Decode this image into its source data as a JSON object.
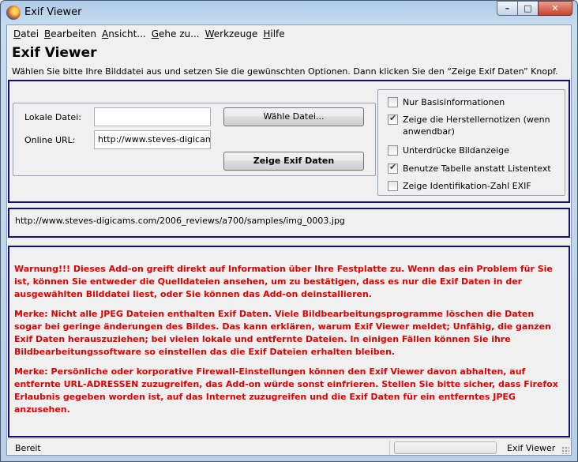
{
  "window": {
    "title": "Exif Viewer",
    "buttons": {
      "minimize": "–",
      "maximize": "□",
      "close": "✕"
    }
  },
  "menubar": {
    "items": [
      {
        "label": "Datei",
        "accel": "D",
        "rest": "atei"
      },
      {
        "label": "Bearbeiten",
        "accel": "B",
        "rest": "earbeiten"
      },
      {
        "label": "Ansicht...",
        "accel": "A",
        "rest": "nsicht..."
      },
      {
        "label": "Gehe zu...",
        "accel": "G",
        "rest": "ehe zu..."
      },
      {
        "label": "Werkzeuge",
        "accel": "W",
        "rest": "erkzeuge"
      },
      {
        "label": "Hilfe",
        "accel": "H",
        "rest": "ilfe"
      }
    ]
  },
  "header": {
    "title": "Exif Viewer",
    "instruction": "Wählen Sie bitte Ihre Bilddatei aus und setzen Sie die gewünschten Optionen. Dann klicken Sie den “Zeige Exif Daten” Knopf."
  },
  "file_box": {
    "local_label": "Lokale Datei:",
    "local_value": "",
    "online_label": "Online URL:",
    "online_value": "http://www.steves-digicam",
    "choose_button": "Wähle Datei...",
    "show_button": "Zeige Exif Daten"
  },
  "options": [
    {
      "label": "Nur Basisinformationen",
      "checked": false
    },
    {
      "label": "Zeige die Herstellernotizen (wenn anwendbar)",
      "checked": true
    },
    {
      "label": "Unterdrücke Bildanzeige",
      "checked": false
    },
    {
      "label": "Benutze Tabelle anstatt Listentext",
      "checked": true
    },
    {
      "label": "Zeige Identifikation-Zahl EXIF",
      "checked": false
    }
  ],
  "url_display": "http://www.steves-digicams.com/2006_reviews/a700/samples/img_0003.jpg",
  "warnings": [
    "Warnung!!! Dieses Add-on greift direkt auf Information über Ihre Festplatte zu. Wenn das ein Problem für Sie ist, können Sie entweder die Quelldateien ansehen, um zu bestätigen, dass es nur die Exif Daten in der ausgewählten Bilddatei liest, oder Sie können das Add-on deinstallieren.",
    "Merke: Nicht alle JPEG Dateien enthalten Exif Daten. Viele Bildbearbeitungsprogramme löschen die Daten sogar bei geringe änderungen des Bildes. Das kann erklären, warum Exif Viewer meldet; Unfähig, die ganzen Exif Daten herauszuziehen; bei vielen lokale und entfernte Dateien. In einigen Fällen können Sie ihre Bildbearbeitungssoftware so einstellen das die Exif Dateien erhalten bleiben.",
    "Merke: Persönliche oder korporative Firewall-Einstellungen können den Exif Viewer davon abhalten, auf entfernte URL-ADRESSEN zuzugreifen, das Add-on würde sonst einfrieren. Stellen Sie bitte sicher, dass Firefox Erlaubnis gegeben worden ist, auf das Internet zuzugreifen und die Exif Daten für ein entferntes JPEG anzusehen."
  ],
  "statusbar": {
    "status": "Bereit",
    "app_name": "Exif Viewer"
  },
  "colors": {
    "warning_text": "#e10000",
    "group_border": "#10107a"
  }
}
